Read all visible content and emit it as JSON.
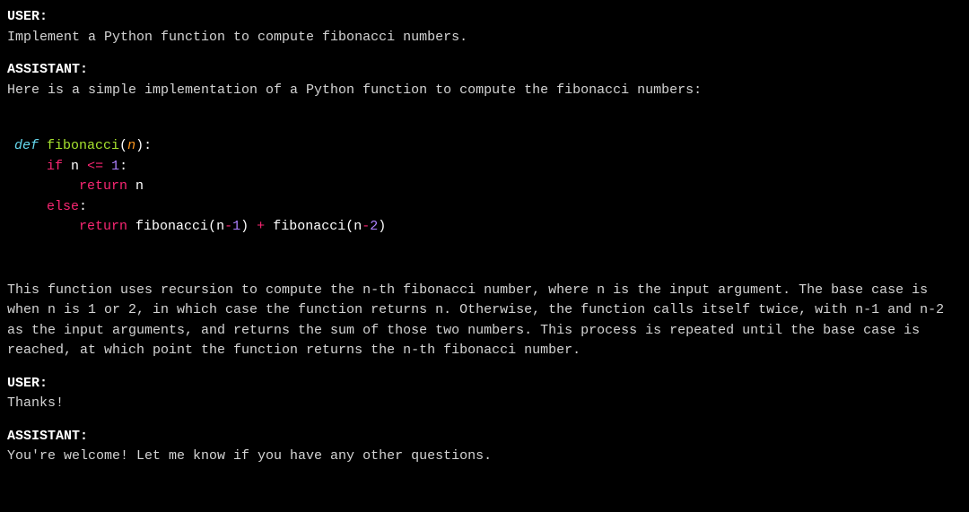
{
  "turns": [
    {
      "role": "USER:",
      "text": "Implement a Python function to compute fibonacci numbers."
    },
    {
      "role": "ASSISTANT:",
      "text": "Here is a simple implementation of a Python function to compute the fibonacci numbers:"
    }
  ],
  "code": {
    "line1": {
      "def": "def",
      "fn": "fibonacci",
      "open": "(",
      "param": "n",
      "close": ")",
      "colon": ":"
    },
    "line2": {
      "indent": "    ",
      "if": "if",
      "var": "n",
      "op": "<=",
      "num": "1",
      "colon": ":"
    },
    "line3": {
      "indent": "        ",
      "return": "return",
      "var": "n"
    },
    "line4": {
      "indent": "    ",
      "else": "else",
      "colon": ":"
    },
    "line5": {
      "indent": "        ",
      "return": "return",
      "call1": "fibonacci",
      "open1": "(",
      "var1": "n",
      "minus1": "-",
      "num1": "1",
      "close1": ")",
      "plus": "+",
      "call2": "fibonacci",
      "open2": "(",
      "var2": "n",
      "minus2": "-",
      "num2": "2",
      "close2": ")"
    }
  },
  "explanation": "This function uses recursion to compute the n-th fibonacci number, where n is the input argument. The base case is when n is 1 or 2, in which case the function returns n. Otherwise, the function calls itself twice, with n-1 and n-2 as the input arguments, and returns the sum of those two numbers. This process is repeated until the base case is reached, at which point the function returns the n-th fibonacci number.",
  "turns2": [
    {
      "role": "USER:",
      "text": "Thanks!"
    },
    {
      "role": "ASSISTANT:",
      "text": "You're welcome! Let me know if you have any other questions."
    }
  ]
}
